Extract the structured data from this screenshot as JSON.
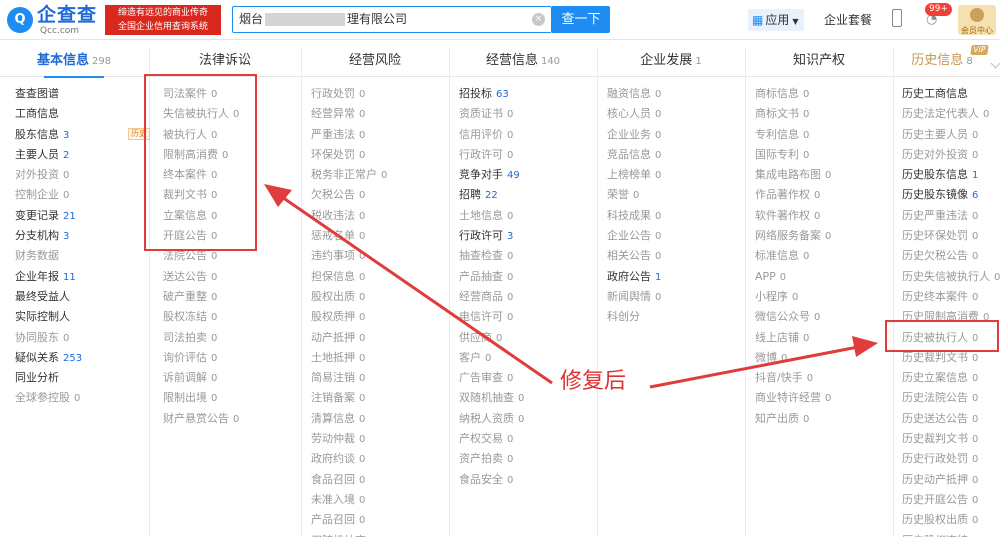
{
  "header": {
    "logo_mark": "Q",
    "logo_name": "企查查",
    "logo_url": "Qcc.com",
    "slogan_line1": "缔造有远见的商业传奇",
    "slogan_line2": "全国企业信用查询系统",
    "search_prefix": "烟台",
    "search_suffix": "理有限公司",
    "search_button": "查一下",
    "apps_label": "应用",
    "package_label": "企业套餐",
    "notification_count": "99+",
    "vip_label": "会员中心"
  },
  "tabs": [
    {
      "label": "基本信息",
      "count": "298"
    },
    {
      "label": "法律诉讼",
      "count": ""
    },
    {
      "label": "经营风险",
      "count": ""
    },
    {
      "label": "经营信息",
      "count": "140"
    },
    {
      "label": "企业发展",
      "count": "1"
    },
    {
      "label": "知识产权",
      "count": ""
    },
    {
      "label": "历史信息",
      "count": "8",
      "tag": "VIP"
    }
  ],
  "columns": [
    [
      {
        "label": "查查图谱",
        "count": ""
      },
      {
        "label": "工商信息",
        "count": ""
      },
      {
        "label": "股东信息",
        "count": "3",
        "blue": true
      },
      {
        "label": "主要人员",
        "count": "2",
        "blue": true
      },
      {
        "label": "对外投资",
        "count": "0",
        "dim": true
      },
      {
        "label": "控制企业",
        "count": "0",
        "dim": true
      },
      {
        "label": "变更记录",
        "count": "21",
        "blue": true
      },
      {
        "label": "分支机构",
        "count": "3",
        "blue": true
      },
      {
        "label": "财务数据",
        "count": "",
        "dim": true
      },
      {
        "label": "企业年报",
        "count": "11",
        "blue": true
      },
      {
        "label": "最终受益人",
        "count": ""
      },
      {
        "label": "实际控制人",
        "count": ""
      },
      {
        "label": "协同股东",
        "count": "0",
        "dim": true
      },
      {
        "label": "疑似关系",
        "count": "253",
        "blue": true
      },
      {
        "label": "同业分析",
        "count": ""
      },
      {
        "label": "全球参控股",
        "count": "0",
        "dim": true
      }
    ],
    [
      {
        "label": "司法案件",
        "count": "0",
        "dim": true
      },
      {
        "label": "失信被执行人",
        "count": "0",
        "dim": true
      },
      {
        "label": "被执行人",
        "count": "0",
        "dim": true
      },
      {
        "label": "限制高消费",
        "count": "0",
        "dim": true
      },
      {
        "label": "终本案件",
        "count": "0",
        "dim": true
      },
      {
        "label": "裁判文书",
        "count": "0",
        "dim": true
      },
      {
        "label": "立案信息",
        "count": "0",
        "dim": true
      },
      {
        "label": "开庭公告",
        "count": "0",
        "dim": true
      },
      {
        "label": "法院公告",
        "count": "0",
        "dim": true
      },
      {
        "label": "送达公告",
        "count": "0",
        "dim": true
      },
      {
        "label": "破产重整",
        "count": "0",
        "dim": true
      },
      {
        "label": "股权冻结",
        "count": "0",
        "dim": true
      },
      {
        "label": "司法拍卖",
        "count": "0",
        "dim": true
      },
      {
        "label": "询价评估",
        "count": "0",
        "dim": true
      },
      {
        "label": "诉前调解",
        "count": "0",
        "dim": true
      },
      {
        "label": "限制出境",
        "count": "0",
        "dim": true
      },
      {
        "label": "财产悬赏公告",
        "count": "0",
        "dim": true
      }
    ],
    [
      {
        "label": "行政处罚",
        "count": "0",
        "dim": true
      },
      {
        "label": "经营异常",
        "count": "0",
        "dim": true
      },
      {
        "label": "严重违法",
        "count": "0",
        "dim": true
      },
      {
        "label": "环保处罚",
        "count": "0",
        "dim": true
      },
      {
        "label": "税务非正常户",
        "count": "0",
        "dim": true
      },
      {
        "label": "欠税公告",
        "count": "0",
        "dim": true
      },
      {
        "label": "税收违法",
        "count": "0",
        "dim": true
      },
      {
        "label": "惩戒名单",
        "count": "0",
        "dim": true
      },
      {
        "label": "违约事项",
        "count": "0",
        "dim": true
      },
      {
        "label": "担保信息",
        "count": "0",
        "dim": true
      },
      {
        "label": "股权出质",
        "count": "0",
        "dim": true
      },
      {
        "label": "股权质押",
        "count": "0",
        "dim": true
      },
      {
        "label": "动产抵押",
        "count": "0",
        "dim": true
      },
      {
        "label": "土地抵押",
        "count": "0",
        "dim": true
      },
      {
        "label": "简易注销",
        "count": "0",
        "dim": true
      },
      {
        "label": "注销备案",
        "count": "0",
        "dim": true
      },
      {
        "label": "清算信息",
        "count": "0",
        "dim": true
      },
      {
        "label": "劳动仲裁",
        "count": "0",
        "dim": true
      },
      {
        "label": "政府约谈",
        "count": "0",
        "dim": true
      },
      {
        "label": "食品召回",
        "count": "0",
        "dim": true
      },
      {
        "label": "未准入境",
        "count": "0",
        "dim": true
      },
      {
        "label": "产品召回",
        "count": "0",
        "dim": true
      },
      {
        "label": "双随机抽查",
        "count": "0",
        "dim": true
      }
    ],
    [
      {
        "label": "招投标",
        "count": "63",
        "blue": true
      },
      {
        "label": "资质证书",
        "count": "0",
        "dim": true
      },
      {
        "label": "信用评价",
        "count": "0",
        "dim": true
      },
      {
        "label": "行政许可",
        "count": "0",
        "dim": true
      },
      {
        "label": "竞争对手",
        "count": "49",
        "blue": true
      },
      {
        "label": "招聘",
        "count": "22",
        "blue": true
      },
      {
        "label": "土地信息",
        "count": "0",
        "dim": true
      },
      {
        "label": "行政许可",
        "count": "3",
        "blue": true
      },
      {
        "label": "抽查检查",
        "count": "0",
        "dim": true
      },
      {
        "label": "产品抽查",
        "count": "0",
        "dim": true
      },
      {
        "label": "经营商品",
        "count": "0",
        "dim": true
      },
      {
        "label": "电信许可",
        "count": "0",
        "dim": true
      },
      {
        "label": "供应商",
        "count": "0",
        "dim": true
      },
      {
        "label": "客户",
        "count": "0",
        "dim": true
      },
      {
        "label": "广告审查",
        "count": "0",
        "dim": true
      },
      {
        "label": "双随机抽查",
        "count": "0",
        "dim": true
      },
      {
        "label": "纳税人资质",
        "count": "0",
        "dim": true
      },
      {
        "label": "产权交易",
        "count": "0",
        "dim": true
      },
      {
        "label": "资产拍卖",
        "count": "0",
        "dim": true
      },
      {
        "label": "食品安全",
        "count": "0",
        "dim": true
      }
    ],
    [
      {
        "label": "融资信息",
        "count": "0",
        "dim": true
      },
      {
        "label": "核心人员",
        "count": "0",
        "dim": true
      },
      {
        "label": "企业业务",
        "count": "0",
        "dim": true
      },
      {
        "label": "竞品信息",
        "count": "0",
        "dim": true
      },
      {
        "label": "上榜榜单",
        "count": "0",
        "dim": true
      },
      {
        "label": "荣誉",
        "count": "0",
        "dim": true
      },
      {
        "label": "科技成果",
        "count": "0",
        "dim": true
      },
      {
        "label": "企业公告",
        "count": "0",
        "dim": true
      },
      {
        "label": "相关公告",
        "count": "0",
        "dim": true
      },
      {
        "label": "政府公告",
        "count": "1",
        "blue": true
      },
      {
        "label": "新闻舆情",
        "count": "0",
        "dim": true
      },
      {
        "label": "科创分",
        "count": "",
        "dim": true
      }
    ],
    [
      {
        "label": "商标信息",
        "count": "0",
        "dim": true
      },
      {
        "label": "商标文书",
        "count": "0",
        "dim": true
      },
      {
        "label": "专利信息",
        "count": "0",
        "dim": true
      },
      {
        "label": "国际专利",
        "count": "0",
        "dim": true
      },
      {
        "label": "集成电路布图",
        "count": "0",
        "dim": true
      },
      {
        "label": "作品著作权",
        "count": "0",
        "dim": true
      },
      {
        "label": "软件著作权",
        "count": "0",
        "dim": true
      },
      {
        "label": "网络服务备案",
        "count": "0",
        "dim": true
      },
      {
        "label": "标准信息",
        "count": "0",
        "dim": true
      },
      {
        "label": "APP",
        "count": "0",
        "dim": true
      },
      {
        "label": "小程序",
        "count": "0",
        "dim": true
      },
      {
        "label": "微信公众号",
        "count": "0",
        "dim": true
      },
      {
        "label": "线上店铺",
        "count": "0",
        "dim": true
      },
      {
        "label": "微博",
        "count": "0",
        "dim": true
      },
      {
        "label": "抖音/快手",
        "count": "0",
        "dim": true
      },
      {
        "label": "商业特许经营",
        "count": "0",
        "dim": true
      },
      {
        "label": "知产出质",
        "count": "0",
        "dim": true
      }
    ],
    [
      {
        "label": "历史工商信息",
        "count": ""
      },
      {
        "label": "历史法定代表人",
        "count": "0",
        "dim": true
      },
      {
        "label": "历史主要人员",
        "count": "0",
        "dim": true
      },
      {
        "label": "历史对外投资",
        "count": "0",
        "dim": true
      },
      {
        "label": "历史股东信息",
        "count": "1",
        "blue": true
      },
      {
        "label": "历史股东镜像",
        "count": "6",
        "blue": true
      },
      {
        "label": "历史严重违法",
        "count": "0",
        "dim": true
      },
      {
        "label": "历史环保处罚",
        "count": "0",
        "dim": true
      },
      {
        "label": "历史欠税公告",
        "count": "0",
        "dim": true
      },
      {
        "label": "历史失信被执行人",
        "count": "0",
        "dim": true
      },
      {
        "label": "历史终本案件",
        "count": "0",
        "dim": true
      },
      {
        "label": "历史限制高消费",
        "count": "0",
        "dim": true
      },
      {
        "label": "历史被执行人",
        "count": "0",
        "dim": true
      },
      {
        "label": "历史裁判文书",
        "count": "0",
        "dim": true
      },
      {
        "label": "历史立案信息",
        "count": "0",
        "dim": true
      },
      {
        "label": "历史法院公告",
        "count": "0",
        "dim": true
      },
      {
        "label": "历史送达公告",
        "count": "0",
        "dim": true
      },
      {
        "label": "历史裁判文书",
        "count": "0",
        "dim": true
      },
      {
        "label": "历史行政处罚",
        "count": "0",
        "dim": true
      },
      {
        "label": "历史动产抵押",
        "count": "0",
        "dim": true
      },
      {
        "label": "历史开庭公告",
        "count": "0",
        "dim": true
      },
      {
        "label": "历史股权出质",
        "count": "0",
        "dim": true
      },
      {
        "label": "历史股权冻结",
        "count": "0",
        "dim": true
      }
    ]
  ],
  "basic_info_tag": "历史",
  "annotation": {
    "text": "修复后",
    "color": "#e03030"
  },
  "colors": {
    "brand": "#1e8cf0",
    "history_gold": "#c4974d",
    "highlight_red": "#e03c3c"
  }
}
